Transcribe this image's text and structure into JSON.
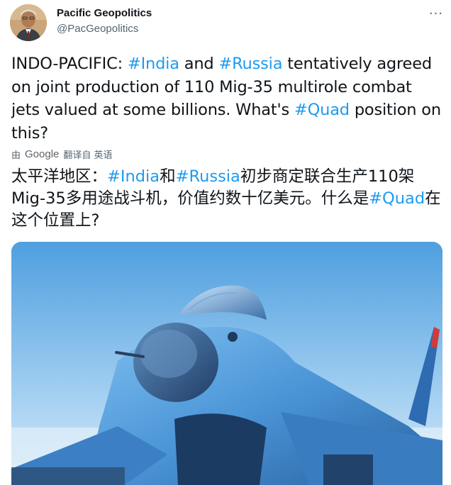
{
  "author": {
    "name": "Pacific Geopolitics",
    "handle": "@PacGeopolitics"
  },
  "menu": {
    "more_glyph": "···"
  },
  "tweet": {
    "prefix": "INDO-PACIFIC: ",
    "tag_india": "#India",
    "and": " and ",
    "tag_russia": "#Russia",
    "middle": " tentatively agreed on joint production of 110 Mig-35 multirole combat jets valued at some billions. What's ",
    "tag_quad": "#Quad",
    "suffix": " position on this?"
  },
  "translation_bar": {
    "by": "由",
    "google": "Google",
    "action": "翻译自 英语"
  },
  "translated": {
    "prefix": "太平洋地区：",
    "tag_india": "#India",
    "and": "和",
    "tag_russia": "#Russia",
    "middle": "初步商定联合生产110架Mig-35多用途战斗机，价值约数十亿美元。什么是",
    "tag_quad": "#Quad",
    "suffix": "在这个位置上?"
  },
  "colors": {
    "link": "#1d9bf0",
    "text": "#0f1419",
    "secondary": "#536471",
    "sky_top": "#4f9fe0",
    "sky_bottom": "#cfe6f7"
  },
  "media": {
    "subject": "MiG-35 fighter jet photo"
  }
}
